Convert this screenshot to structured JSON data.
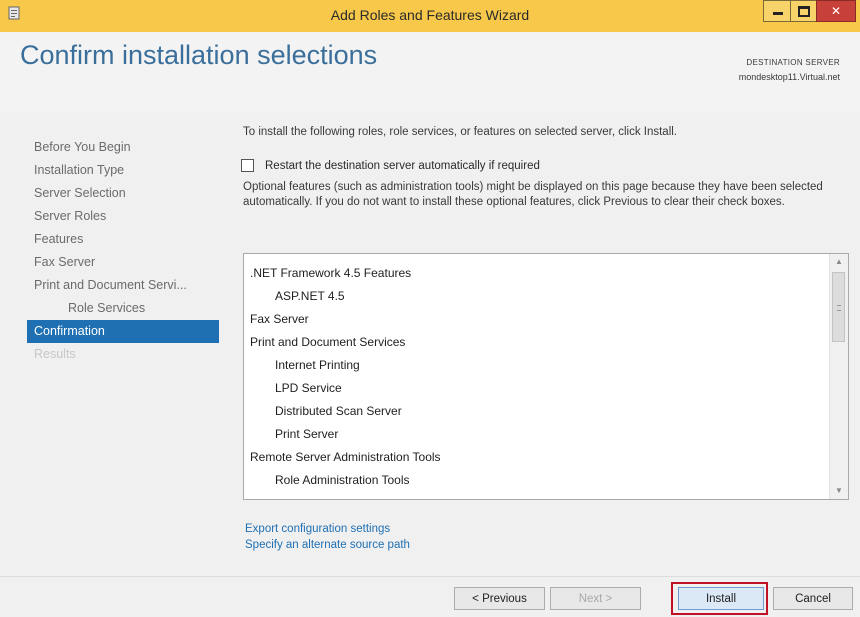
{
  "window": {
    "title": "Add Roles and Features Wizard",
    "accent_color": "#f7c84a"
  },
  "header": {
    "page_title": "Confirm installation selections",
    "destination_label": "DESTINATION SERVER",
    "destination_value": "mondesktop11.Virtual.net"
  },
  "nav": {
    "items": [
      {
        "label": "Before You Begin",
        "state": "normal"
      },
      {
        "label": "Installation Type",
        "state": "normal"
      },
      {
        "label": "Server Selection",
        "state": "normal"
      },
      {
        "label": "Server Roles",
        "state": "normal"
      },
      {
        "label": "Features",
        "state": "normal"
      },
      {
        "label": "Fax Server",
        "state": "normal"
      },
      {
        "label": "Print and Document Servi...",
        "state": "normal"
      },
      {
        "label": "Role Services",
        "state": "sub"
      },
      {
        "label": "Confirmation",
        "state": "active"
      },
      {
        "label": "Results",
        "state": "faded"
      }
    ],
    "active_color": "#1f6fb3"
  },
  "main": {
    "intro": "To install the following roles, role services, or features on selected server, click Install.",
    "restart_label": "Restart the destination server automatically if required",
    "restart_checked": false,
    "optional_text": "Optional features (such as administration tools) might be displayed on this page because they have been selected automatically. If you do not want to install these optional features, click Previous to clear their check boxes.",
    "selections": [
      {
        "label": ".NET Framework 4.5 Features",
        "level": 0
      },
      {
        "label": "ASP.NET 4.5",
        "level": 1
      },
      {
        "label": "Fax Server",
        "level": 0
      },
      {
        "label": "Print and Document Services",
        "level": 0
      },
      {
        "label": "Internet Printing",
        "level": 1
      },
      {
        "label": "LPD Service",
        "level": 1
      },
      {
        "label": "Distributed Scan Server",
        "level": 1
      },
      {
        "label": "Print Server",
        "level": 1
      },
      {
        "label": "Remote Server Administration Tools",
        "level": 0
      },
      {
        "label": "Role Administration Tools",
        "level": 1
      }
    ],
    "export_link": "Export configuration settings",
    "alternate_link": "Specify an alternate source path"
  },
  "footer": {
    "previous_label": "< Previous",
    "next_label": "Next >",
    "install_label": "Install",
    "cancel_label": "Cancel",
    "highlight_color": "#c01028"
  }
}
